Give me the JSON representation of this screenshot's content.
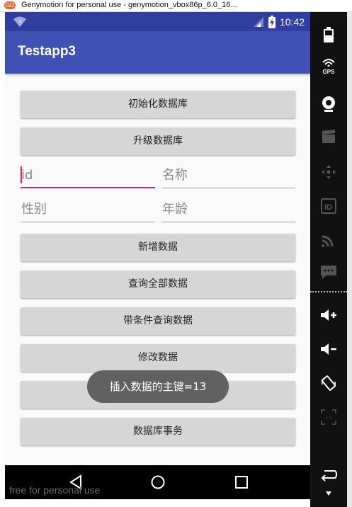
{
  "window": {
    "title": "Genymotion for personal use - genymotion_vbox86p_6.0_16...",
    "logo_text": "GO"
  },
  "status_bar": {
    "time": "10:42",
    "wifi_badge": "?"
  },
  "app_bar": {
    "title": "Testapp3"
  },
  "buttons": {
    "init_db": "初始化数据库",
    "upgrade_db": "升级数据库",
    "add_data": "新增数据",
    "query_all": "查询全部数据",
    "query_conditional": "带条件查询数据",
    "modify_data": "修改数据",
    "delete_data": "",
    "transaction": "数据库事务"
  },
  "fields": {
    "id": {
      "placeholder": "id",
      "value": ""
    },
    "name": {
      "placeholder": "名称",
      "value": ""
    },
    "gender": {
      "placeholder": "性别",
      "value": ""
    },
    "age": {
      "placeholder": "年龄",
      "value": ""
    }
  },
  "toast": {
    "message": "插入数据的主键=13"
  },
  "watermark": "free for personal use",
  "side_toolbar": {
    "gps_label": "GPS",
    "id_label": "ID"
  },
  "colors": {
    "status_bar": "#303f9f",
    "app_bar": "#3f51b5",
    "accent": "#e91e63",
    "button": "#d6d6d6",
    "toast": "#616161"
  }
}
